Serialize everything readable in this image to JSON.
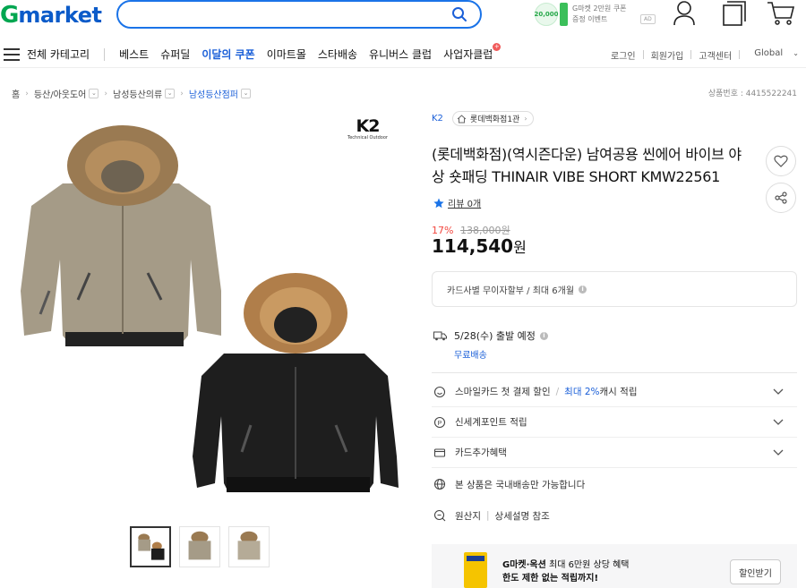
{
  "header": {
    "logo_g": "G",
    "logo_rest": "market",
    "search": {
      "value": "",
      "placeholder": ""
    },
    "promo": {
      "coin": "20,000",
      "line1": "G마켓 2만원 쿠폰",
      "line2": "증정 이벤트",
      "ad": "AD"
    }
  },
  "nav": {
    "all_categories": "전체 카테고리",
    "items": [
      "베스트",
      "슈퍼딜",
      "이달의 쿠폰",
      "이마트몰",
      "스타배송",
      "유니버스 클럽",
      "사업자클럽"
    ],
    "right": [
      "로그인",
      "회원가입",
      "고객센터",
      "Global"
    ]
  },
  "breadcrumb": {
    "home": "홈",
    "items": [
      "등산/아웃도어",
      "남성등산의류",
      "남성등산점퍼"
    ]
  },
  "product_no": "상품번호 : 4415522241",
  "brand_logo": {
    "main": "K2",
    "sub": "Technical Outdoor"
  },
  "product": {
    "brand": "K2",
    "store": "롯데백화점1관",
    "title": "(롯데백화점)(역시즌다운) 남여공용 씬에어 바이브 야상 숏패딩 THINAIR VIBE SHORT KMW22561",
    "review": "리뷰 0개",
    "discount_pct": "17%",
    "original_price": "138,000원",
    "price": "114,540",
    "price_unit": "원"
  },
  "card_installment": "카드사별 무이자할부 / 최대 6개월",
  "shipping": {
    "date": "5/28(수) 출발 예정",
    "free": "무료배송"
  },
  "benefits": {
    "smile_card": {
      "a": "스마일카드 첫 결제 할인",
      "sep": "/",
      "b": "최대 2%",
      "c": " 캐시 적립"
    },
    "shinsegae": "신세계포인트 적립",
    "card_extra": "카드추가혜택",
    "domestic": "본 상품은 국내배송만 가능합니다",
    "origin": "원산지",
    "origin_detail": "상세설명 참조"
  },
  "banner": {
    "line1_bold": "G마켓·옥션",
    "line1_rest": " 최대 6만원 상당 혜택",
    "line2": "한도 제한 없는 적립까지!",
    "button": "할인받기"
  },
  "colors": {
    "accent": "#1a5fd8",
    "logo_green": "#00a650",
    "logo_blue": "#0b5bc9",
    "discount": "#f2473f"
  },
  "icons": [
    "search-icon",
    "user-icon",
    "cart-icon",
    "recent-icon",
    "heart-icon",
    "share-icon",
    "star-icon",
    "truck-icon",
    "chevron-down-icon",
    "home-icon"
  ]
}
